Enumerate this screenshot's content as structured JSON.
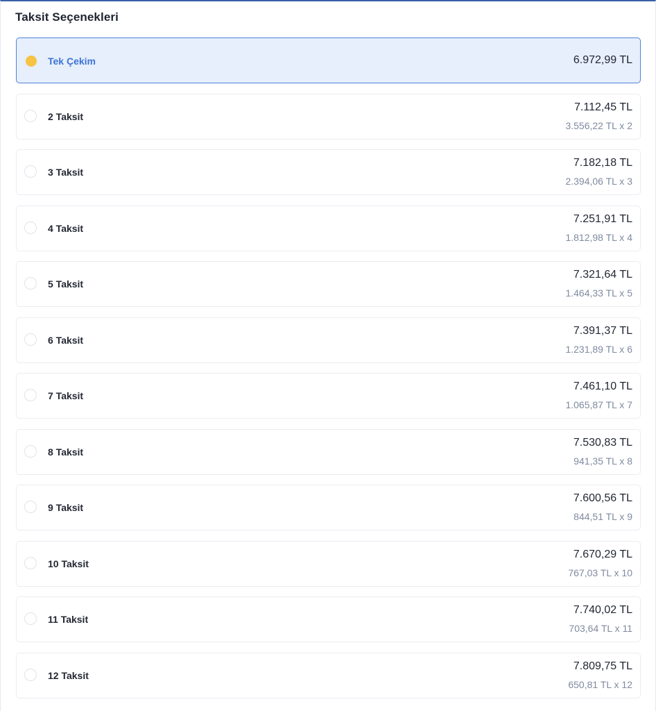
{
  "header": {
    "title": "Taksit Seçenekleri"
  },
  "options": [
    {
      "label": "Tek Çekim",
      "total": "6.972,99 TL",
      "monthly": "",
      "selected": true
    },
    {
      "label": "2 Taksit",
      "total": "7.112,45 TL",
      "monthly": "3.556,22 TL x 2",
      "selected": false
    },
    {
      "label": "3 Taksit",
      "total": "7.182,18 TL",
      "monthly": "2.394,06 TL x 3",
      "selected": false
    },
    {
      "label": "4 Taksit",
      "total": "7.251,91 TL",
      "monthly": "1.812,98 TL x 4",
      "selected": false
    },
    {
      "label": "5 Taksit",
      "total": "7.321,64 TL",
      "monthly": "1.464,33 TL x 5",
      "selected": false
    },
    {
      "label": "6 Taksit",
      "total": "7.391,37 TL",
      "monthly": "1.231,89 TL x 6",
      "selected": false
    },
    {
      "label": "7 Taksit",
      "total": "7.461,10 TL",
      "monthly": "1.065,87 TL x 7",
      "selected": false
    },
    {
      "label": "8 Taksit",
      "total": "7.530,83 TL",
      "monthly": "941,35 TL x 8",
      "selected": false
    },
    {
      "label": "9 Taksit",
      "total": "7.600,56 TL",
      "monthly": "844,51 TL x 9",
      "selected": false
    },
    {
      "label": "10 Taksit",
      "total": "7.670,29 TL",
      "monthly": "767,03 TL x 10",
      "selected": false
    },
    {
      "label": "11 Taksit",
      "total": "7.740,02 TL",
      "monthly": "703,64 TL x 11",
      "selected": false
    },
    {
      "label": "12 Taksit",
      "total": "7.809,75 TL",
      "monthly": "650,81 TL x 12",
      "selected": false
    }
  ],
  "colors": {
    "selected_background": "#e6effb",
    "selected_border": "#4f82d8",
    "selected_label": "#3d73d6",
    "radio_selected": "#f6c343",
    "monthly_text": "#7f8aa0"
  }
}
